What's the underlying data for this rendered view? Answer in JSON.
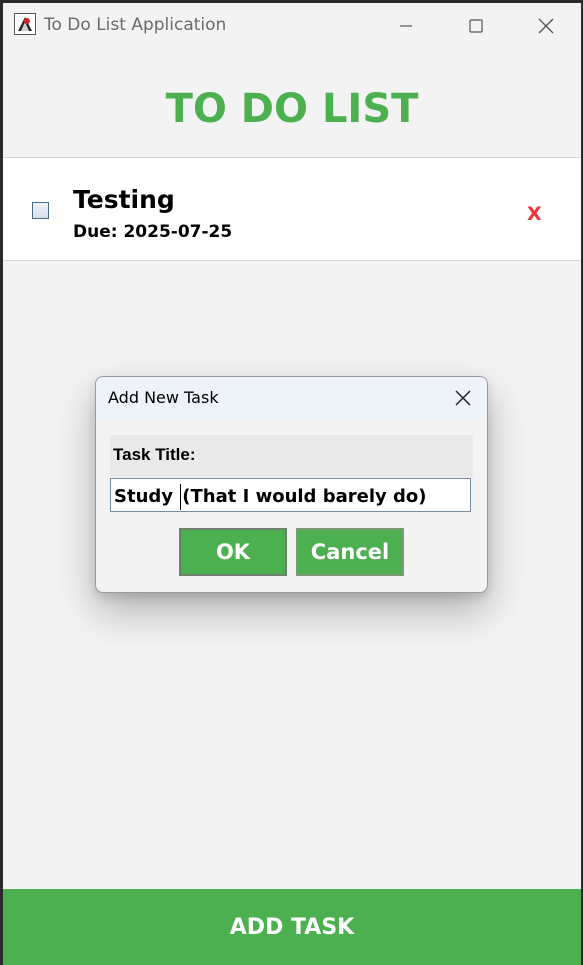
{
  "window": {
    "title": "To Do List Application",
    "icon": "java-app-icon",
    "controls": [
      "minimize-icon",
      "maximize-icon",
      "close-icon"
    ]
  },
  "header": {
    "title": "TO DO LIST",
    "color": "#4caf50"
  },
  "tasks": [
    {
      "title": "Testing",
      "due": "Due: 2025-07-25",
      "completed": false,
      "delete_label": "X"
    }
  ],
  "footer": {
    "add_task_label": "ADD TASK",
    "color": "#4caf50"
  },
  "dialog": {
    "title": "Add New Task",
    "field_label": "Task Title:",
    "input_before_caret": "Study ",
    "input_after_caret": "(That I would barely do)",
    "ok_label": "OK",
    "cancel_label": "Cancel"
  },
  "colors": {
    "accent_green": "#4caf50",
    "delete_red": "#e53935"
  }
}
